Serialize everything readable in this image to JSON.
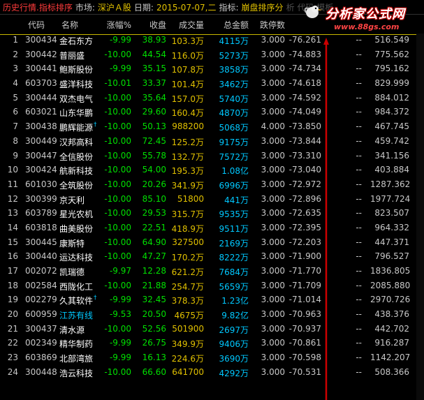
{
  "titlebar": {
    "mode": "历史行情.指标排序",
    "market_label": "市场:",
    "market_value": "深沪Ａ股",
    "date_label": "日期:",
    "date_value": "2015-07-07,二",
    "indicator_label": "指标:",
    "indicator_value": "崩盘排序分",
    "faded": "析 代码 模板"
  },
  "logo": {
    "main": "分析家公式网",
    "url": "www.88gs.com"
  },
  "header": {
    "code": "代码",
    "name": "名称",
    "change": "涨幅%",
    "close": "收盘",
    "volume": "成交量",
    "amount": "总金额",
    "days": "跌停数",
    "indicator": "",
    "x1": "",
    "x2": ""
  },
  "rows": [
    {
      "idx": "1",
      "code": "300434",
      "name": "金石东方",
      "change": "-9.99",
      "close": "38.93",
      "volume": "103.3万",
      "amount": "4115万",
      "days": "3.000",
      "ind": "-76.261",
      "x1": "--",
      "x2": "516.549",
      "cyan": false,
      "marker": false
    },
    {
      "idx": "2",
      "code": "300442",
      "name": "普丽盛",
      "change": "-10.00",
      "close": "44.54",
      "volume": "116.0万",
      "amount": "5273万",
      "days": "3.000",
      "ind": "-74.883",
      "x1": "--",
      "x2": "775.562",
      "cyan": false,
      "marker": false
    },
    {
      "idx": "3",
      "code": "300441",
      "name": "鲍斯股份",
      "change": "-9.99",
      "close": "35.15",
      "volume": "107.8万",
      "amount": "3858万",
      "days": "3.000",
      "ind": "-74.734",
      "x1": "--",
      "x2": "795.162",
      "cyan": false,
      "marker": false
    },
    {
      "idx": "4",
      "code": "603703",
      "name": "盛洋科技",
      "change": "-10.01",
      "close": "33.37",
      "volume": "101.4万",
      "amount": "3462万",
      "days": "3.000",
      "ind": "-74.618",
      "x1": "--",
      "x2": "829.999",
      "cyan": false,
      "marker": false
    },
    {
      "idx": "5",
      "code": "300444",
      "name": "双杰电气",
      "change": "-10.00",
      "close": "35.64",
      "volume": "157.0万",
      "amount": "5740万",
      "days": "3.000",
      "ind": "-74.592",
      "x1": "--",
      "x2": "884.012",
      "cyan": false,
      "marker": false
    },
    {
      "idx": "6",
      "code": "603021",
      "name": "山东华鹏",
      "change": "-10.00",
      "close": "29.60",
      "volume": "160.4万",
      "amount": "4870万",
      "days": "3.000",
      "ind": "-74.049",
      "x1": "--",
      "x2": "984.372",
      "cyan": false,
      "marker": false
    },
    {
      "idx": "7",
      "code": "300438",
      "name": "鹏辉能源",
      "change": "-10.00",
      "close": "50.13",
      "volume": "988200",
      "amount": "5068万",
      "days": "4.000",
      "ind": "-73.850",
      "x1": "--",
      "x2": "467.745",
      "cyan": false,
      "marker": true
    },
    {
      "idx": "8",
      "code": "300449",
      "name": "汉邦高科",
      "change": "-10.00",
      "close": "72.45",
      "volume": "125.2万",
      "amount": "9175万",
      "days": "3.000",
      "ind": "-73.844",
      "x1": "--",
      "x2": "459.742",
      "cyan": false,
      "marker": false
    },
    {
      "idx": "9",
      "code": "300447",
      "name": "全信股份",
      "change": "-10.00",
      "close": "55.78",
      "volume": "132.7万",
      "amount": "7572万",
      "days": "3.000",
      "ind": "-73.310",
      "x1": "--",
      "x2": "341.156",
      "cyan": false,
      "marker": false
    },
    {
      "idx": "10",
      "code": "300424",
      "name": "航新科技",
      "change": "-10.00",
      "close": "54.00",
      "volume": "195.3万",
      "amount": "1.08亿",
      "days": "3.000",
      "ind": "-73.040",
      "x1": "--",
      "x2": "403.884",
      "cyan": false,
      "marker": false
    },
    {
      "idx": "11",
      "code": "601030",
      "name": "全筑股份",
      "change": "-10.00",
      "close": "20.26",
      "volume": "341.9万",
      "amount": "6996万",
      "days": "3.000",
      "ind": "-72.972",
      "x1": "--",
      "x2": "1287.362",
      "cyan": false,
      "marker": false
    },
    {
      "idx": "12",
      "code": "300399",
      "name": "京天利",
      "change": "-10.00",
      "close": "85.10",
      "volume": "51800",
      "amount": "441万",
      "days": "3.000",
      "ind": "-72.896",
      "x1": "--",
      "x2": "1977.724",
      "cyan": false,
      "marker": false
    },
    {
      "idx": "13",
      "code": "603789",
      "name": "星光农机",
      "change": "-10.00",
      "close": "29.53",
      "volume": "315.7万",
      "amount": "9535万",
      "days": "3.000",
      "ind": "-72.635",
      "x1": "--",
      "x2": "823.507",
      "cyan": false,
      "marker": false
    },
    {
      "idx": "14",
      "code": "603818",
      "name": "曲美股份",
      "change": "-10.00",
      "close": "22.51",
      "volume": "418.9万",
      "amount": "9511万",
      "days": "3.000",
      "ind": "-72.395",
      "x1": "--",
      "x2": "964.332",
      "cyan": false,
      "marker": false
    },
    {
      "idx": "15",
      "code": "300445",
      "name": "康斯特",
      "change": "-10.00",
      "close": "64.90",
      "volume": "327500",
      "amount": "2169万",
      "days": "3.000",
      "ind": "-72.203",
      "x1": "--",
      "x2": "447.371",
      "cyan": false,
      "marker": false
    },
    {
      "idx": "16",
      "code": "300440",
      "name": "运达科技",
      "change": "-10.00",
      "close": "47.27",
      "volume": "170.2万",
      "amount": "8222万",
      "days": "3.000",
      "ind": "-71.900",
      "x1": "--",
      "x2": "796.527",
      "cyan": false,
      "marker": false
    },
    {
      "idx": "17",
      "code": "002072",
      "name": "凯瑞德",
      "change": "-9.97",
      "close": "12.28",
      "volume": "621.2万",
      "amount": "7684万",
      "days": "3.000",
      "ind": "-71.770",
      "x1": "--",
      "x2": "1836.805",
      "cyan": false,
      "marker": false
    },
    {
      "idx": "18",
      "code": "002584",
      "name": "西陇化工",
      "change": "-10.00",
      "close": "21.88",
      "volume": "254.7万",
      "amount": "5659万",
      "days": "3.000",
      "ind": "-71.709",
      "x1": "--",
      "x2": "2085.880",
      "cyan": false,
      "marker": false
    },
    {
      "idx": "19",
      "code": "002279",
      "name": "久其软件",
      "change": "-9.99",
      "close": "32.45",
      "volume": "378.3万",
      "amount": "1.23亿",
      "days": "3.000",
      "ind": "-71.014",
      "x1": "--",
      "x2": "2970.726",
      "cyan": false,
      "marker": true
    },
    {
      "idx": "20",
      "code": "600959",
      "name": "江苏有线",
      "change": "-9.53",
      "close": "20.50",
      "volume": "4675万",
      "amount": "9.82亿",
      "days": "3.000",
      "ind": "-70.963",
      "x1": "--",
      "x2": "438.376",
      "cyan": true,
      "marker": false
    },
    {
      "idx": "21",
      "code": "300437",
      "name": "清水源",
      "change": "-10.00",
      "close": "52.56",
      "volume": "501900",
      "amount": "2697万",
      "days": "3.000",
      "ind": "-70.937",
      "x1": "--",
      "x2": "442.702",
      "cyan": false,
      "marker": false
    },
    {
      "idx": "22",
      "code": "002349",
      "name": "精华制药",
      "change": "-9.99",
      "close": "26.75",
      "volume": "349.9万",
      "amount": "9406万",
      "days": "3.000",
      "ind": "-70.861",
      "x1": "--",
      "x2": "916.287",
      "cyan": false,
      "marker": false
    },
    {
      "idx": "23",
      "code": "603869",
      "name": "北部湾旅",
      "change": "-9.99",
      "close": "16.13",
      "volume": "224.6万",
      "amount": "3690万",
      "days": "3.000",
      "ind": "-70.598",
      "x1": "--",
      "x2": "1142.207",
      "cyan": false,
      "marker": false
    },
    {
      "idx": "24",
      "code": "300448",
      "name": "浩云科技",
      "change": "-10.00",
      "close": "66.60",
      "volume": "641700",
      "amount": "4292万",
      "days": "3.000",
      "ind": "-70.531",
      "x1": "--",
      "x2": "508.366",
      "cyan": false,
      "marker": false
    }
  ],
  "colors": {
    "background": "#000000",
    "title_red": "#ff3b3b",
    "down_green": "#00e000",
    "volume_yellow": "#e0c000",
    "amount_cyan": "#00c8ff",
    "arrow_red": "#cc0000"
  }
}
